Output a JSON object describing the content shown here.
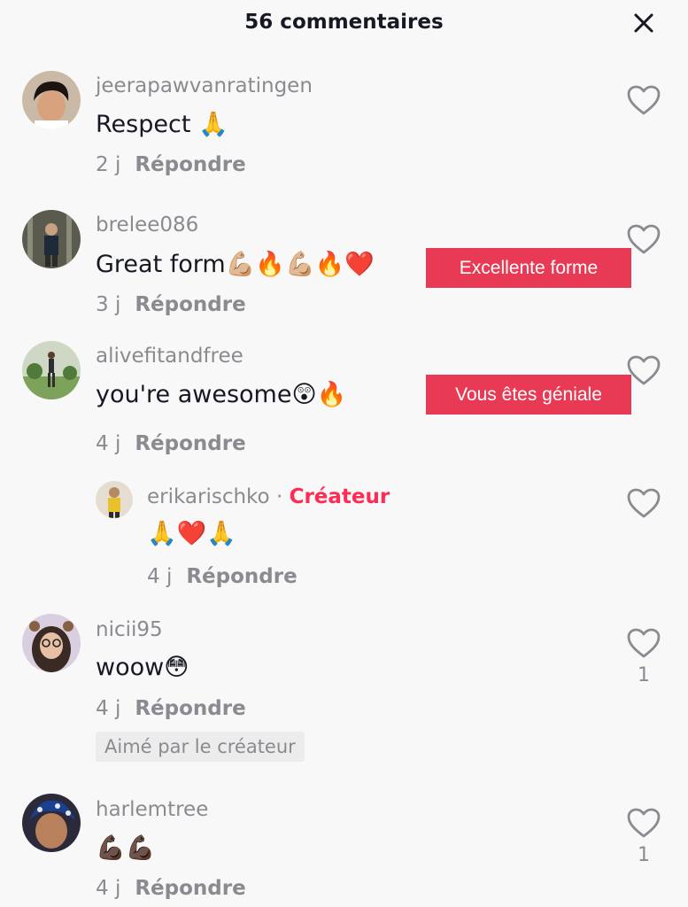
{
  "header": {
    "title": "56 commentaires"
  },
  "icons": {
    "close": "close-icon",
    "like": "heart-outline-icon"
  },
  "colors": {
    "accent": "#fe2c55",
    "translate_badge": "#e83a54",
    "muted": "#8a8b91"
  },
  "comments": [
    {
      "username": "jeerapawvanratingen",
      "text": "Respect 🙏",
      "time": "2 j",
      "reply": "Répondre"
    },
    {
      "username": "brelee086",
      "text": "Great form💪🏼🔥💪🏼🔥❤️",
      "time": "3 j",
      "reply": "Répondre",
      "translation": "Excellente forme"
    },
    {
      "username": "alivefitandfree",
      "text": "you're awesome😲🔥",
      "time": "4 j",
      "reply": "Répondre",
      "translation": "Vous êtes géniale"
    },
    {
      "username": "erikarischko",
      "creator_separator": "·",
      "creator_label": "Créateur",
      "text": "🙏❤️🙏",
      "time": "4 j",
      "reply": "Répondre"
    },
    {
      "username": "nicii95",
      "text": "woow😳",
      "time": "4 j",
      "reply": "Répondre",
      "likes": "1",
      "liked_by_creator": "Aimé par le créateur"
    },
    {
      "username": "harlemtree",
      "text": "💪🏿💪🏿",
      "time": "4 j",
      "reply": "Répondre",
      "likes": "1"
    }
  ]
}
